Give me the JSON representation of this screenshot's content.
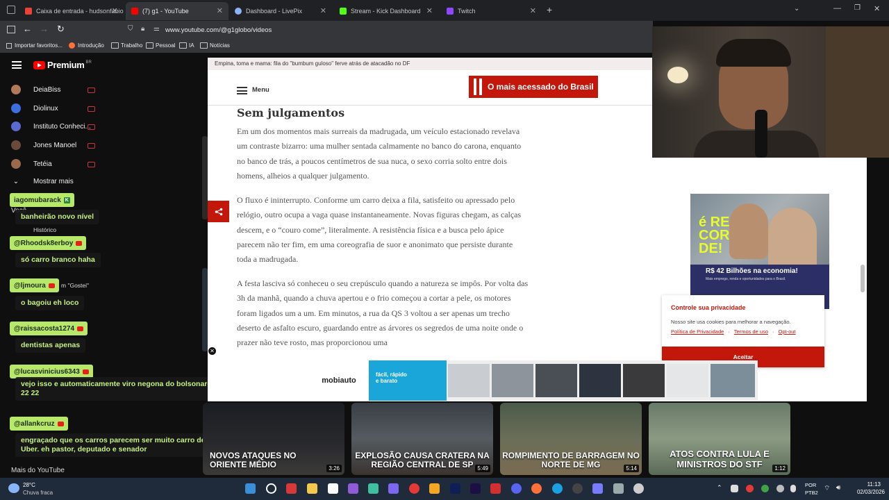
{
  "tabs": [
    {
      "title": "Caixa de entrada - hudsonfabio"
    },
    {
      "title": "(7) g1 - YouTube"
    },
    {
      "title": "Dashboard - LivePix"
    },
    {
      "title": "Stream - Kick Dashboard"
    },
    {
      "title": "Twitch"
    }
  ],
  "url": "www.youtube.com/@g1globo/videos",
  "bookmarks": [
    "Importar favoritos...",
    "Introdução",
    "Trabalho",
    "Pessoal",
    "IA",
    "Notícias"
  ],
  "yt": {
    "logo_text": "Premium",
    "region": "BR",
    "channels": [
      "DeiaBiss",
      "Diolinux",
      "Instituto Conheci...",
      "Jones Manoel",
      "Tetéia"
    ],
    "show_more": "Mostrar mais",
    "you_label": "Você",
    "history_label": "Histórico",
    "liked_label": "m \"Gostei\"",
    "more_from": "Mais do YouTube"
  },
  "chat": [
    {
      "user": "iagomubarack",
      "message": "banheirão novo nível",
      "badge": "kick"
    },
    {
      "user": "@Rhoodsk8erboy",
      "message": "só carro branco haha",
      "badge": "yt"
    },
    {
      "user": "@ljmoura",
      "message": "o bagoiu eh loco",
      "badge": "yt"
    },
    {
      "user": "@raissacosta1274",
      "message": "dentistas apenas",
      "badge": "yt"
    },
    {
      "user": "@lucasvinicius6343",
      "message": "vejo isso e automaticamente viro negona do bolsonaro 22 22",
      "badge": "yt"
    },
    {
      "user": "@allankcruz",
      "message": "engraçado que os carros parecem ser muito carro de Uber. eh pastor, deputado e senador",
      "badge": "yt"
    }
  ],
  "article": {
    "notice": "Empina, toma e mama: fila do \"bumbum guloso\" ferve atrás de atacadão no DF",
    "menu_label": "Menu",
    "banner": "O mais acessado do Brasil",
    "section_title": "Sem julgamentos",
    "paragraphs": [
      "Em um dos momentos mais surreais da madrugada, um veículo estacionado revelava um contraste bizarro: uma mulher sentada calmamente no banco do carona, enquanto no banco de trás, a poucos centímetros de sua nuca, o sexo corria solto entre dois homens, alheios a qualquer julgamento.",
      "O fluxo é ininterrupto. Conforme um carro deixa a fila, satisfeito ou apressado pelo relógio, outro ocupa a vaga quase instantaneamente. Novas figuras chegam, as calças descem, e o “couro come”, literalmente. A resistência física e a busca pelo ápice parecem não ter fim, em uma coreografia de suor e anonimato que persiste durante toda a madrugada.",
      "A festa lasciva só conheceu o seu crepúsculo quando a natureza se impôs. Por volta das 3h da manhã, quando a chuva apertou e o frio começou a cortar a pele, os motores foram ligados um a um. Em minutos, a rua da QS 3 voltou a ser apenas um trecho deserto de asfalto escuro, guardando entre as árvores os segredos de uma noite onde o prazer não teve rosto, mas proporcionou uma"
    ],
    "ad": {
      "big": "é RE COR DE!",
      "amount": "R$ 42 Bilhões na economia!",
      "sub": "Mais emprego, renda e oportunidades para o Brasil."
    },
    "privacy": {
      "title": "Controle sua privacidade",
      "text": "Nosso site usa cookies para melhorar a navegação.",
      "links": [
        "Política de Privacidade",
        "Termos de uso",
        "Opt-out"
      ],
      "accept": "Aceitar"
    },
    "strip_brand": "mobiauto",
    "strip_promo": [
      "fácil, rápido",
      "e barato"
    ]
  },
  "videos": [
    {
      "title": "NOVOS ATAQUES NO ORIENTE MÉDIO",
      "duration": "3:26"
    },
    {
      "title": "EXPLOSÃO CAUSA CRATERA NA REGIÃO CENTRAL DE SP",
      "duration": "5:49"
    },
    {
      "title": "ROMPIMENTO DE BARRAGEM NO NORTE DE MG",
      "duration": "5:14"
    },
    {
      "title": "ATOS CONTRA LULA E MINISTROS DO STF",
      "duration": "1:12"
    }
  ],
  "taskbar": {
    "temp": "28°C",
    "weather": "Chuva fraca",
    "lang1": "POR",
    "lang2": "PTB2",
    "time": "11:13",
    "date": "02/03/2026"
  },
  "colors": {
    "accent_red": "#c4170c",
    "chat_name_bg": "#b8e86a",
    "chat_text": "#c6f082"
  }
}
